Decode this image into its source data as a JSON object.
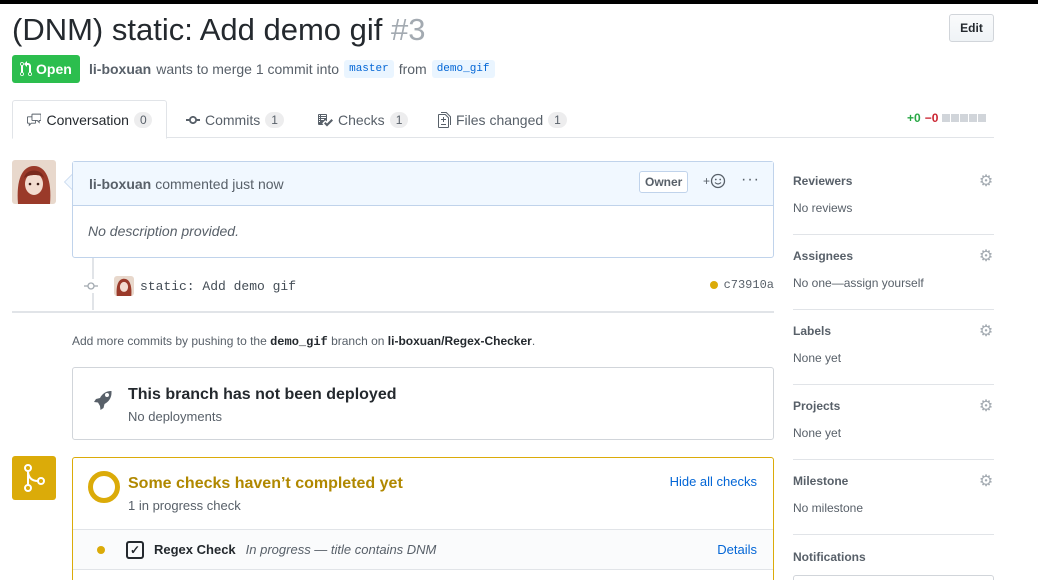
{
  "pr": {
    "title": "(DNM) static: Add demo gif",
    "number": "#3",
    "edit_label": "Edit",
    "state_label": "Open",
    "author": "li-boxuan",
    "merge_text": "wants to merge 1 commit into",
    "base_branch": "master",
    "from_text": "from",
    "head_branch": "demo_gif"
  },
  "tabs": [
    {
      "label": "Conversation",
      "count": "0"
    },
    {
      "label": "Commits",
      "count": "1"
    },
    {
      "label": "Checks",
      "count": "1"
    },
    {
      "label": "Files changed",
      "count": "1"
    }
  ],
  "diffstat": {
    "additions": "+0",
    "deletions": "−0"
  },
  "comment": {
    "author": "li-boxuan",
    "action": "commented just now",
    "badge": "Owner",
    "body": "No description provided."
  },
  "commit": {
    "message": "static: Add demo gif",
    "sha": "c73910a"
  },
  "push_note": {
    "prefix": "Add more commits by pushing to the",
    "branch": "demo_gif",
    "middle": "branch on",
    "repo": "li-boxuan/Regex-Checker",
    "suffix": "."
  },
  "deploy": {
    "title": "This branch has not been deployed",
    "subtitle": "No deployments"
  },
  "checks": {
    "title": "Some checks haven’t completed yet",
    "subtitle": "1 in progress check",
    "hide_label": "Hide all checks",
    "items": [
      {
        "name": "Regex Check",
        "description": "In progress — title contains DNM",
        "details": "Details"
      }
    ]
  },
  "sidebar": {
    "sections": [
      {
        "heading": "Reviewers",
        "value": "No reviews"
      },
      {
        "heading": "Assignees",
        "value": "No one—assign yourself"
      },
      {
        "heading": "Labels",
        "value": "None yet"
      },
      {
        "heading": "Projects",
        "value": "None yet"
      },
      {
        "heading": "Milestone",
        "value": "No milestone"
      }
    ],
    "notifications_heading": "Notifications"
  },
  "colors": {
    "open_green": "#2cbe4e",
    "pending_yellow": "#dbab09",
    "link_blue": "#0366d6"
  },
  "icons": [
    "git-pull-request-icon",
    "comment-icon",
    "commit-icon",
    "checklist-icon",
    "file-diff-icon",
    "smiley-icon",
    "kebab-icon",
    "rocket-icon",
    "git-merge-icon",
    "gear-icon"
  ]
}
